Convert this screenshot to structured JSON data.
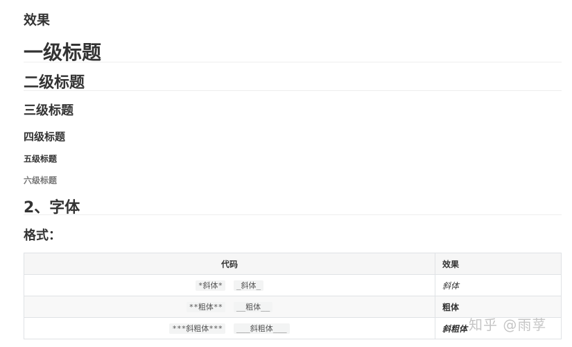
{
  "effect_heading": "效果",
  "headings": {
    "h1": "一级标题",
    "h2": "二级标题",
    "h3": "三级标题",
    "h4": "四级标题",
    "h5": "五级标题",
    "h6": "六级标题"
  },
  "section2": "2、字体",
  "format_label": "格式：",
  "table": {
    "headers": [
      "代码",
      "效果"
    ],
    "rows": [
      {
        "code_a": "*斜体*",
        "code_b": "_斜体_",
        "effect": "斜体"
      },
      {
        "code_a": "**粗体**",
        "code_b": "__粗体__",
        "effect": "粗体"
      },
      {
        "code_a": "***斜粗体***",
        "code_b": "___斜粗体___",
        "effect": "斜粗体"
      }
    ]
  },
  "watermark": "知乎 @雨莩"
}
